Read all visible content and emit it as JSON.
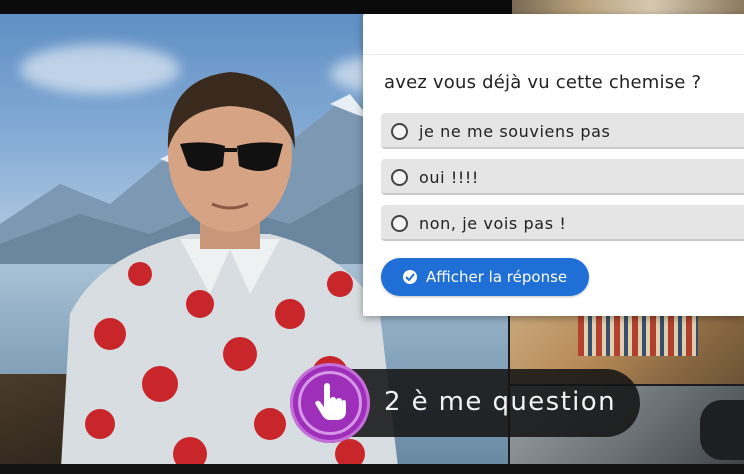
{
  "quiz": {
    "question": "avez vous déjà vu cette chemise ?",
    "options": [
      {
        "label": "je ne me souviens pas"
      },
      {
        "label": "oui !!!!"
      },
      {
        "label": "non, je vois pas !"
      }
    ],
    "reveal_label": "Afficher la réponse",
    "accent_color": "#1f6fd6"
  },
  "interaction": {
    "label": "2 è me question",
    "button_icon": "hand-pointer-icon",
    "button_color": "#9e2fba"
  }
}
